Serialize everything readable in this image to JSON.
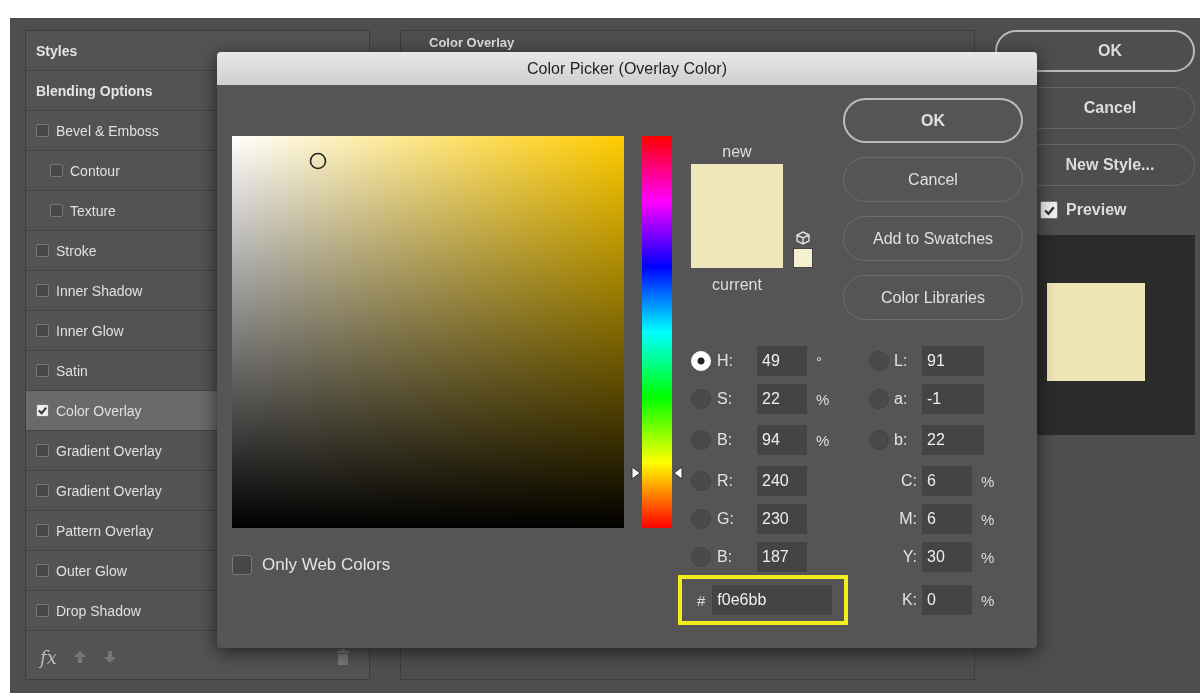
{
  "layer_style": {
    "styles": [
      {
        "label": "Styles",
        "kind": "header",
        "selected": false
      },
      {
        "label": "Blending Options",
        "kind": "header",
        "selected": false
      },
      {
        "label": "Bevel & Emboss",
        "kind": "checkbox",
        "checked": false,
        "selected": false,
        "children": [
          {
            "label": "Contour",
            "kind": "checkbox",
            "checked": false,
            "selected": false
          },
          {
            "label": "Texture",
            "kind": "checkbox",
            "checked": false,
            "selected": false
          }
        ]
      },
      {
        "label": "Stroke",
        "kind": "checkbox",
        "checked": false,
        "selected": false
      },
      {
        "label": "Inner Shadow",
        "kind": "checkbox",
        "checked": false,
        "selected": false
      },
      {
        "label": "Inner Glow",
        "kind": "checkbox",
        "checked": false,
        "selected": false
      },
      {
        "label": "Satin",
        "kind": "checkbox",
        "checked": false,
        "selected": false
      },
      {
        "label": "Color Overlay",
        "kind": "checkbox",
        "checked": true,
        "selected": true
      },
      {
        "label": "Gradient Overlay",
        "kind": "checkbox",
        "checked": false,
        "selected": false
      },
      {
        "label": "Gradient Overlay",
        "kind": "checkbox",
        "checked": false,
        "selected": false
      },
      {
        "label": "Pattern Overlay",
        "kind": "checkbox",
        "checked": false,
        "selected": false
      },
      {
        "label": "Outer Glow",
        "kind": "checkbox",
        "checked": false,
        "selected": false
      },
      {
        "label": "Drop Shadow",
        "kind": "checkbox",
        "checked": false,
        "selected": false
      }
    ],
    "fx_label": "fx",
    "panel_title": "Color Overlay",
    "buttons": [
      "OK",
      "Cancel",
      "New Style..."
    ],
    "preview": {
      "label": "Preview",
      "checked": true,
      "color": "#efe4b4"
    }
  },
  "color_picker": {
    "title": "Color Picker (Overlay Color)",
    "hue_slider": {
      "level": 0.14
    },
    "new_label": "new",
    "current_label": "current",
    "swatches": [
      {
        "color": "#f0e6bb"
      },
      {
        "color": "#f0e6bb"
      }
    ],
    "web_safe_swatch": {
      "color": "#f5f0d0"
    },
    "buttons": [
      "OK",
      "Cancel",
      "Add to Swatches",
      "Color Libraries"
    ],
    "only_web_colors": {
      "label": "Only Web Colors",
      "checked": false
    },
    "left_fields": [
      {
        "label": "H:",
        "value": "49",
        "unit": "°",
        "selected": true
      },
      {
        "label": "S:",
        "value": "22",
        "unit": "%",
        "selected": false
      },
      {
        "label": "B:",
        "value": "94",
        "unit": "%",
        "selected": false
      },
      {
        "label": "R:",
        "value": "240",
        "selected": false
      },
      {
        "label": "G:",
        "value": "230",
        "selected": false
      },
      {
        "label": "B:",
        "value": "187",
        "selected": false
      }
    ],
    "right_fields": [
      {
        "label": "L:",
        "value": "91",
        "kind": "radio",
        "selected": false
      },
      {
        "label": "a:",
        "value": "-1",
        "kind": "radio",
        "selected": false
      },
      {
        "label": "b:",
        "value": "22",
        "kind": "radio",
        "selected": false
      },
      {
        "label": "C:",
        "value": "6",
        "unit": "%",
        "kind": "plain"
      },
      {
        "label": "M:",
        "value": "6",
        "unit": "%",
        "kind": "plain"
      },
      {
        "label": "Y:",
        "value": "30",
        "unit": "%",
        "kind": "plain"
      },
      {
        "label": "K:",
        "value": "0",
        "unit": "%",
        "kind": "plain"
      }
    ],
    "hex": {
      "label": "#",
      "value": "f0e6bb",
      "highlighted": true
    }
  }
}
